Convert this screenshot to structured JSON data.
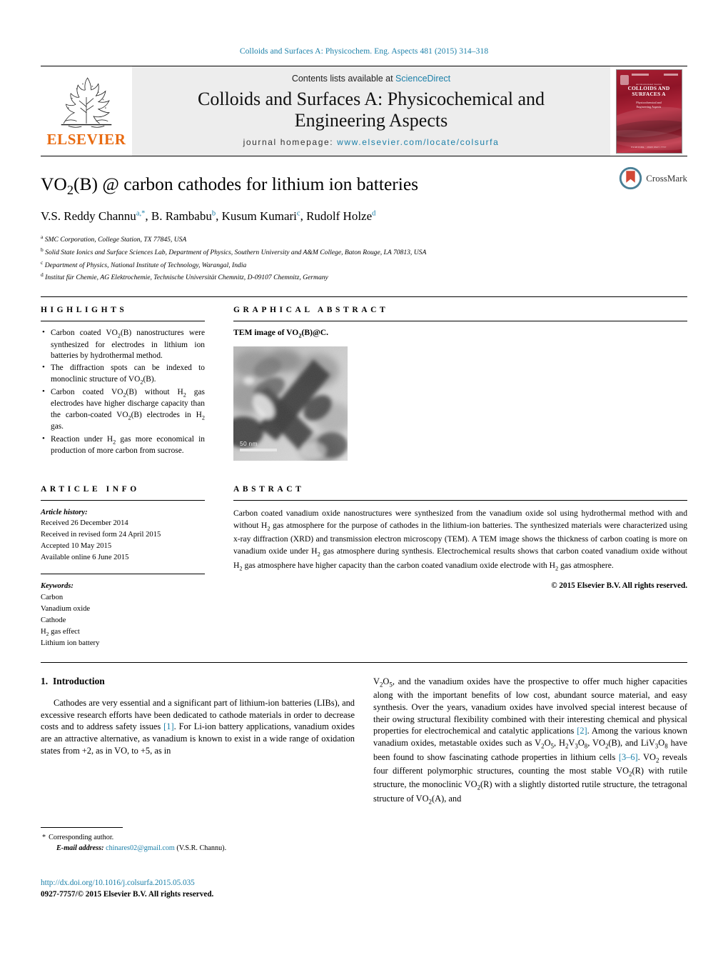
{
  "running_head": "Colloids and Surfaces A: Physicochem. Eng. Aspects 481 (2015) 314–318",
  "masthead": {
    "publisher_name": "ELSEVIER",
    "contents_prefix": "Contents lists available at ",
    "contents_link": "ScienceDirect",
    "journal_title": "Colloids and Surfaces A: Physicochemical and Engineering Aspects",
    "homepage_label": "journal homepage: ",
    "homepage_url": "www.elsevier.com/locate/colsurfa",
    "cover": {
      "top_small": "An International Journal",
      "main_line1": "COLLOIDS AND",
      "main_line2": "SURFACES A",
      "sub_line1": "Physicochemical and",
      "sub_line2": "Engineering Aspects",
      "bottom": "ELSEVIER  ·  ISSN 0927-7757"
    }
  },
  "crossmark": {
    "label": "CrossMark"
  },
  "article": {
    "title": "VO2(B) @ carbon cathodes for lithium ion batteries",
    "title_parts": {
      "pre": "VO",
      "sub": "2",
      "post": "(B) @ carbon cathodes for lithium ion batteries"
    },
    "authors": [
      {
        "name": "V.S. Reddy Channu",
        "marks": "a,*"
      },
      {
        "name": "B. Rambabu",
        "marks": "b"
      },
      {
        "name": "Kusum Kumari",
        "marks": "c"
      },
      {
        "name": "Rudolf Holze",
        "marks": "d"
      }
    ],
    "affiliations": [
      {
        "mark": "a",
        "text": "SMC Corporation, College Station, TX 77845, USA"
      },
      {
        "mark": "b",
        "text": "Solid State Ionics and Surface Sciences Lab, Department of Physics, Southern University and A&M College, Baton Rouge, LA 70813, USA"
      },
      {
        "mark": "c",
        "text": "Department of Physics, National Institute of Technology, Warangal, India"
      },
      {
        "mark": "d",
        "text": "Institut für Chemie, AG Elektrochemie, Technische Universität Chemnitz, D-09107 Chemnitz, Germany"
      }
    ]
  },
  "highlights": {
    "heading": "HIGHLIGHTS",
    "items": [
      "Carbon coated VO2(B) nanostructures were synthesized for electrodes in lithium ion batteries by hydrothermal method.",
      "The diffraction spots can be indexed to monoclinic structure of VO2(B).",
      "Carbon coated VO2(B) without H2 gas electrodes have higher discharge capacity than the carbon-coated VO2(B) electrodes in H2 gas.",
      "Reaction under H2 gas more economical in production of more carbon from sucrose."
    ]
  },
  "graphical_abstract": {
    "heading": "GRAPHICAL ABSTRACT",
    "caption": "TEM image of VO2(B)@C.",
    "scale_bar": "50 nm"
  },
  "article_info": {
    "heading": "ARTICLE INFO",
    "history_label": "Article history:",
    "history": [
      "Received 26 December 2014",
      "Received in revised form 24 April 2015",
      "Accepted 10 May 2015",
      "Available online 6 June 2015"
    ],
    "keywords_label": "Keywords:",
    "keywords": [
      "Carbon",
      "Vanadium oxide",
      "Cathode",
      "H2 gas effect",
      "Lithium ion battery"
    ]
  },
  "abstract": {
    "heading": "ABSTRACT",
    "text": "Carbon coated vanadium oxide nanostructures were synthesized from the vanadium oxide sol using hydrothermal method with and without H2 gas atmosphere for the purpose of cathodes in the lithium-ion batteries. The synthesized materials were characterized using x-ray diffraction (XRD) and transmission electron microscopy (TEM). A TEM image shows the thickness of carbon coating is more on vanadium oxide under H2 gas atmosphere during synthesis. Electrochemical results shows that carbon coated vanadium oxide without H2 gas atmosphere have higher capacity than the carbon coated vanadium oxide electrode with H2 gas atmosphere.",
    "copyright": "© 2015 Elsevier B.V. All rights reserved."
  },
  "introduction": {
    "number": "1.",
    "heading": "Introduction",
    "left_paragraph": "Cathodes are very essential and a significant part of lithium-ion batteries (LIBs), and excessive research efforts have been dedicated to cathode materials in order to decrease costs and to address safety issues [1]. For Li-ion battery applications, vanadium oxides are an attractive alternative, as vanadium is known to exist in a wide range of oxidation states from +2, as in VO, to +5, as in",
    "right_paragraph": "V2O5, and the vanadium oxides have the prospective to offer much higher capacities along with the important benefits of low cost, abundant source material, and easy synthesis. Over the years, vanadium oxides have involved special interest because of their owing structural flexibility combined with their interesting chemical and physical properties for electrochemical and catalytic applications [2]. Among the various known vanadium oxides, metastable oxides such as V2O5, H2V3O8, VO2(B), and LiV3O8 have been found to show fascinating cathode properties in lithium cells [3–6]. VO2 reveals four different polymorphic structures, counting the most stable VO2(R) with rutile structure, the monoclinic VO2(R) with a slightly distorted rutile structure, the tetragonal structure of VO2(A), and",
    "citations": [
      "[1]",
      "[2]",
      "[3–6]"
    ]
  },
  "footnote": {
    "corresponding": "Corresponding author.",
    "email_label": "E-mail address:",
    "email": "chinares02@gmail.com",
    "email_owner": "(V.S.R. Channu)."
  },
  "footer": {
    "doi": "http://dx.doi.org/10.1016/j.colsurfa.2015.05.035",
    "issn_line": "0927-7757/© 2015 Elsevier B.V. All rights reserved."
  },
  "colors": {
    "link": "#1a7fa8",
    "elsevier_orange": "#e86a10",
    "cover_red": "#a81f32"
  }
}
